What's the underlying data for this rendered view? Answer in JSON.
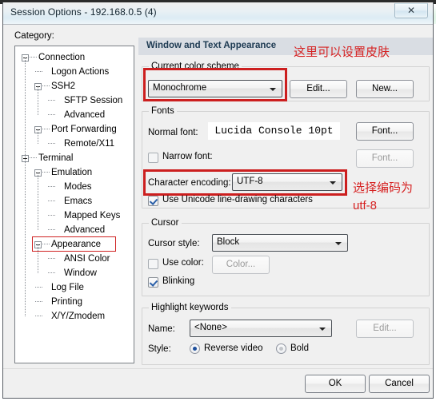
{
  "window": {
    "title": "Session Options - 192.168.0.5 (4)",
    "close_icon": "close-icon",
    "close_glyph": "✕"
  },
  "sidebar": {
    "label": "Category:",
    "selected": "Appearance",
    "items": [
      {
        "label": "Connection",
        "level": 0,
        "expander": true
      },
      {
        "label": "Logon Actions",
        "level": 1,
        "expander": false
      },
      {
        "label": "SSH2",
        "level": 1,
        "expander": true
      },
      {
        "label": "SFTP Session",
        "level": 2,
        "expander": false
      },
      {
        "label": "Advanced",
        "level": 2,
        "expander": false
      },
      {
        "label": "Port Forwarding",
        "level": 1,
        "expander": true
      },
      {
        "label": "Remote/X11",
        "level": 2,
        "expander": false
      },
      {
        "label": "Terminal",
        "level": 0,
        "expander": true
      },
      {
        "label": "Emulation",
        "level": 1,
        "expander": true
      },
      {
        "label": "Modes",
        "level": 2,
        "expander": false
      },
      {
        "label": "Emacs",
        "level": 2,
        "expander": false
      },
      {
        "label": "Mapped Keys",
        "level": 2,
        "expander": false
      },
      {
        "label": "Advanced",
        "level": 2,
        "expander": false
      },
      {
        "label": "Appearance",
        "level": 1,
        "expander": true
      },
      {
        "label": "ANSI Color",
        "level": 2,
        "expander": false
      },
      {
        "label": "Window",
        "level": 2,
        "expander": false
      },
      {
        "label": "Log File",
        "level": 1,
        "expander": false
      },
      {
        "label": "Printing",
        "level": 1,
        "expander": false
      },
      {
        "label": "X/Y/Zmodem",
        "level": 1,
        "expander": false
      }
    ]
  },
  "panel": {
    "header": "Window and Text Appearance",
    "color_scheme": {
      "group_title": "Current color scheme",
      "selected": "Monochrome",
      "edit_label": "Edit...",
      "new_label": "New..."
    },
    "fonts": {
      "group_title": "Fonts",
      "normal_font_label": "Normal font:",
      "normal_font_value": "Lucida Console 10pt",
      "normal_font_button": "Font...",
      "narrow_font_label": "Narrow font:",
      "narrow_font_checked": false,
      "narrow_font_button": "Font...",
      "encoding_label": "Character encoding:",
      "encoding_value": "UTF-8",
      "unicode_label": "Use Unicode line-drawing characters",
      "unicode_checked": true
    },
    "cursor": {
      "group_title": "Cursor",
      "style_label": "Cursor style:",
      "style_value": "Block",
      "use_color_label": "Use color:",
      "use_color_checked": false,
      "color_button": "Color...",
      "blinking_label": "Blinking",
      "blinking_checked": true
    },
    "highlight": {
      "group_title": "Highlight keywords",
      "name_label": "Name:",
      "name_value": "<None>",
      "edit_label": "Edit...",
      "style_label": "Style:",
      "reverse_video_label": "Reverse video",
      "reverse_video_selected": true,
      "bold_label": "Bold",
      "bold_selected": false
    }
  },
  "annotations": {
    "color": "#d62222",
    "skin_note": "这里可以设置皮肤",
    "encoding_note_line1": "选择编码为",
    "encoding_note_line2": "utf-8"
  },
  "footer": {
    "ok_label": "OK",
    "cancel_label": "Cancel"
  }
}
